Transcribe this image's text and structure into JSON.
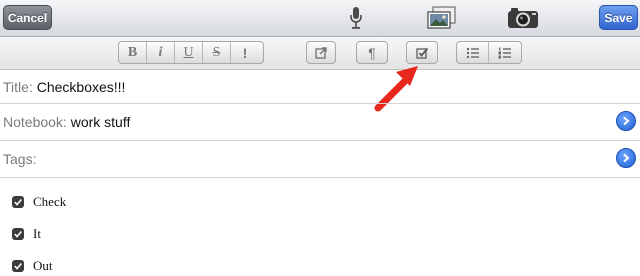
{
  "toolbar": {
    "cancel_label": "Cancel",
    "save_label": "Save",
    "icons": [
      "microphone-icon",
      "photo-library-icon",
      "camera-icon"
    ]
  },
  "format_bar": {
    "bold": "B",
    "italic": "i",
    "underline": "U",
    "strike": "S",
    "important": "!",
    "pilcrow": "¶",
    "icons": [
      "bold-icon",
      "italic-icon",
      "underline-icon",
      "strikethrough-icon",
      "highlight-icon",
      "link-out-icon",
      "paragraph-icon",
      "checkbox-icon",
      "bulleted-list-icon",
      "numbered-list-icon"
    ]
  },
  "fields": {
    "title": {
      "label": "Title:",
      "value": "Checkboxes!!!"
    },
    "notebook": {
      "label": "Notebook:",
      "value": "work stuff"
    },
    "tags": {
      "label": "Tags:",
      "value": ""
    }
  },
  "checklist": [
    {
      "text": "Check",
      "checked": true
    },
    {
      "text": "It",
      "checked": true
    },
    {
      "text": "Out",
      "checked": true
    }
  ],
  "colors": {
    "save_blue": "#2f63d0",
    "arrow_red": "#e8281c",
    "disclosure_blue": "#1f5fd1"
  }
}
